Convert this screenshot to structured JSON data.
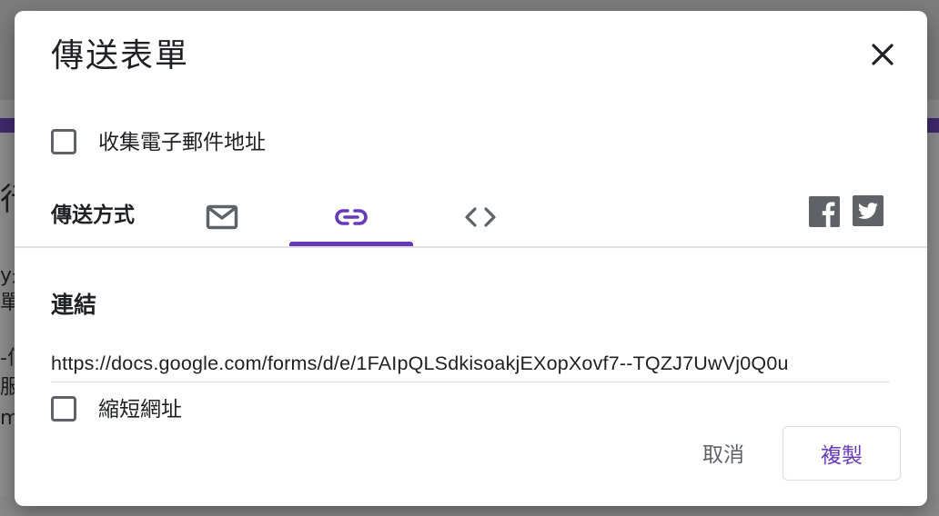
{
  "dialog": {
    "title": "傳送表單",
    "close_icon": "close-icon",
    "collect_email": {
      "label": "收集電子郵件地址",
      "checked": false
    },
    "send_via": {
      "label": "傳送方式",
      "tabs": [
        {
          "id": "email",
          "icon": "email-icon",
          "selected": false
        },
        {
          "id": "link",
          "icon": "link-icon",
          "selected": true
        },
        {
          "id": "embed",
          "icon": "embed-code-icon",
          "selected": false
        }
      ],
      "social": [
        {
          "id": "facebook",
          "icon": "facebook-icon"
        },
        {
          "id": "twitter",
          "icon": "twitter-icon"
        }
      ]
    },
    "link_section": {
      "title": "連結",
      "url": "https://docs.google.com/forms/d/e/1FAIpQLSdkisoakjEXopXovf7--TQZJ7UwVj0Q0u",
      "shorten": {
        "label": "縮短網址",
        "checked": false
      }
    },
    "actions": {
      "cancel_label": "取消",
      "copy_label": "複製"
    }
  },
  "background": {
    "fragments": [
      "行",
      "y是",
      "單",
      "-何",
      "服",
      "m"
    ]
  },
  "colors": {
    "accent": "#673ab7",
    "text": "#202124",
    "icon": "#5f6368",
    "divider": "#e0e0e0",
    "social_bg": "#5f6368"
  }
}
